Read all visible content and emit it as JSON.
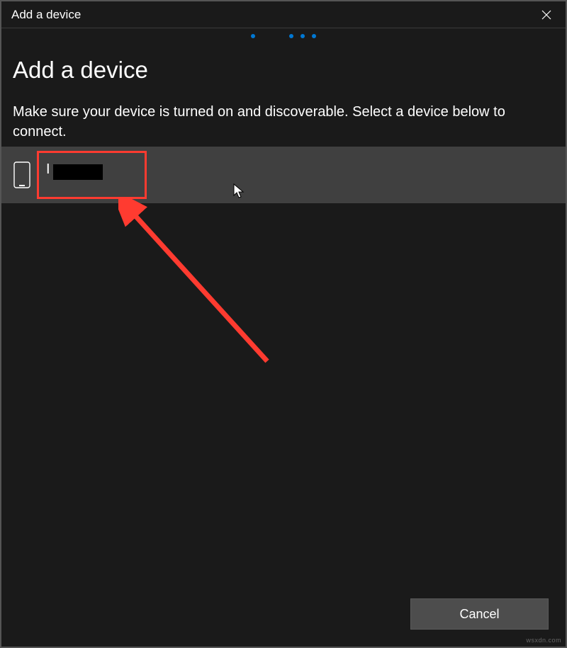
{
  "titlebar": {
    "title": "Add a device"
  },
  "page": {
    "heading": "Add a device",
    "subtitle": "Make sure your device is turned on and discoverable. Select a device below to connect."
  },
  "devices": [
    {
      "label_prefix": "I",
      "redacted": true
    }
  ],
  "buttons": {
    "cancel": "Cancel"
  },
  "watermark": "wsxdn.com"
}
